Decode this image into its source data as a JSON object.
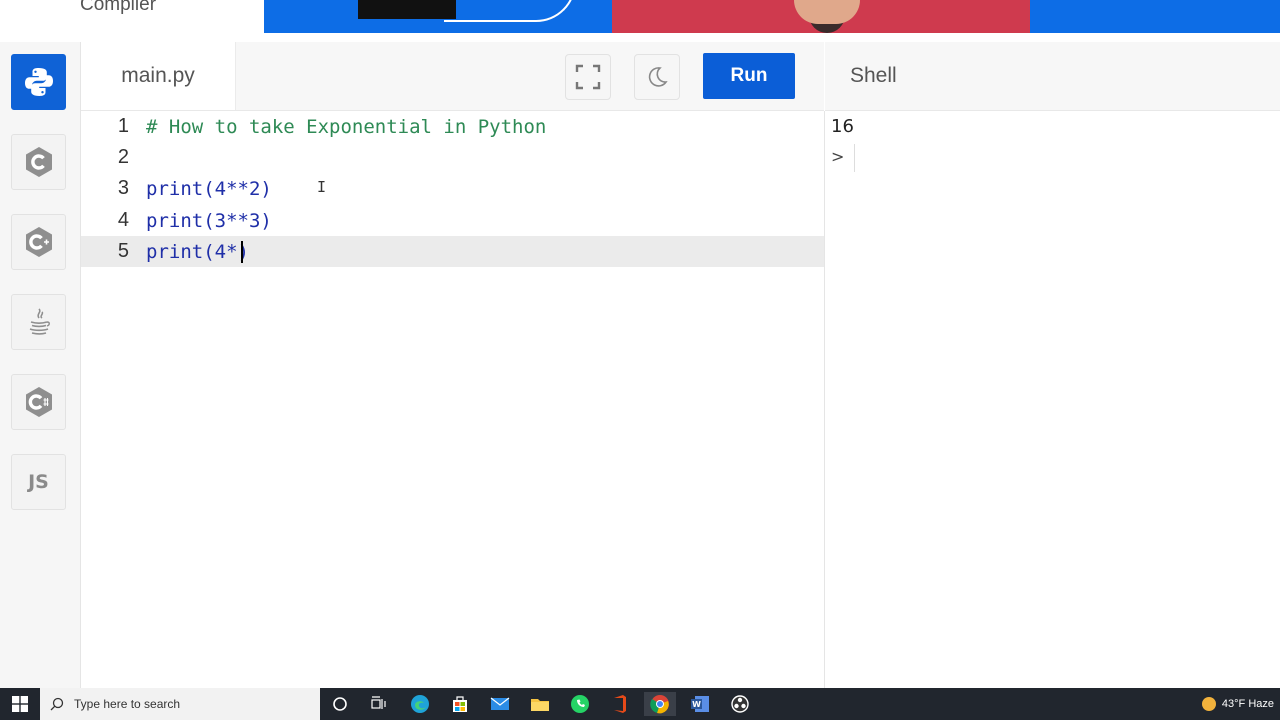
{
  "banner": {
    "brand_text": "Compiler"
  },
  "languages": [
    {
      "name": "Python",
      "icon": "python-icon",
      "active": true
    },
    {
      "name": "C",
      "icon": "c-icon",
      "active": false
    },
    {
      "name": "C++",
      "icon": "cplusplus-icon",
      "active": false
    },
    {
      "name": "Java",
      "icon": "java-icon",
      "active": false
    },
    {
      "name": "C#",
      "icon": "csharp-icon",
      "active": false
    },
    {
      "name": "JS",
      "icon": "js-icon",
      "label": "JS",
      "active": false
    }
  ],
  "editor": {
    "filename": "main.py",
    "run_label": "Run",
    "lines": [
      {
        "num": "1",
        "text": "# How to take Exponential in Python"
      },
      {
        "num": "2",
        "text": ""
      },
      {
        "num": "3",
        "text": "print(4**2)"
      },
      {
        "num": "4",
        "text": "print(3**3)"
      },
      {
        "num": "5",
        "text": "print(4*)"
      }
    ],
    "active_line": 5
  },
  "shell": {
    "title": "Shell",
    "output": "16",
    "prompt": ">"
  },
  "taskbar": {
    "search_placeholder": "Type here to search",
    "weather": "43°F Haze"
  },
  "colors": {
    "accent": "#0b5ed7",
    "comment": "#2e8a55",
    "keyword": "#1f2fa8"
  }
}
